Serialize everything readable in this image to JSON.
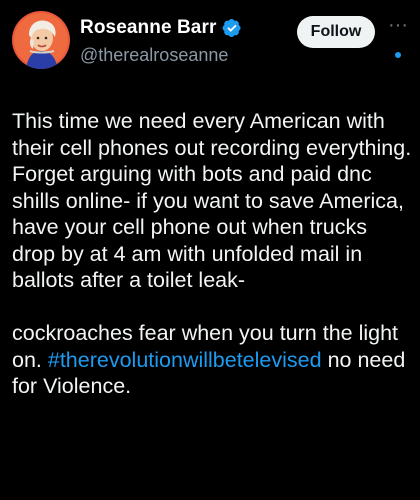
{
  "author": {
    "display_name": "Roseanne Barr",
    "handle": "@therealroseanne",
    "verified": true,
    "avatar": "avatar-photo"
  },
  "actions": {
    "follow_label": "Follow",
    "more_icon": "more-horizontal-icon"
  },
  "tweet": {
    "paragraph1": "This time we need every American with their cell phones out recording everything. Forget arguing with bots and paid dnc shills online- if you want to save America, have your cell phone out when trucks drop by at 4 am with unfolded mail in ballots after a toilet leak-",
    "paragraph2_before": "cockroaches fear when you turn the light on.",
    "hashtag": "#therevolutionwillbetelevised",
    "paragraph2_after": "no need for Violence."
  },
  "colors": {
    "background": "#000000",
    "text": "#e7e9ea",
    "secondary_text": "#8b98a5",
    "accent": "#1d9bf0",
    "follow_bg": "#eff3f4"
  }
}
